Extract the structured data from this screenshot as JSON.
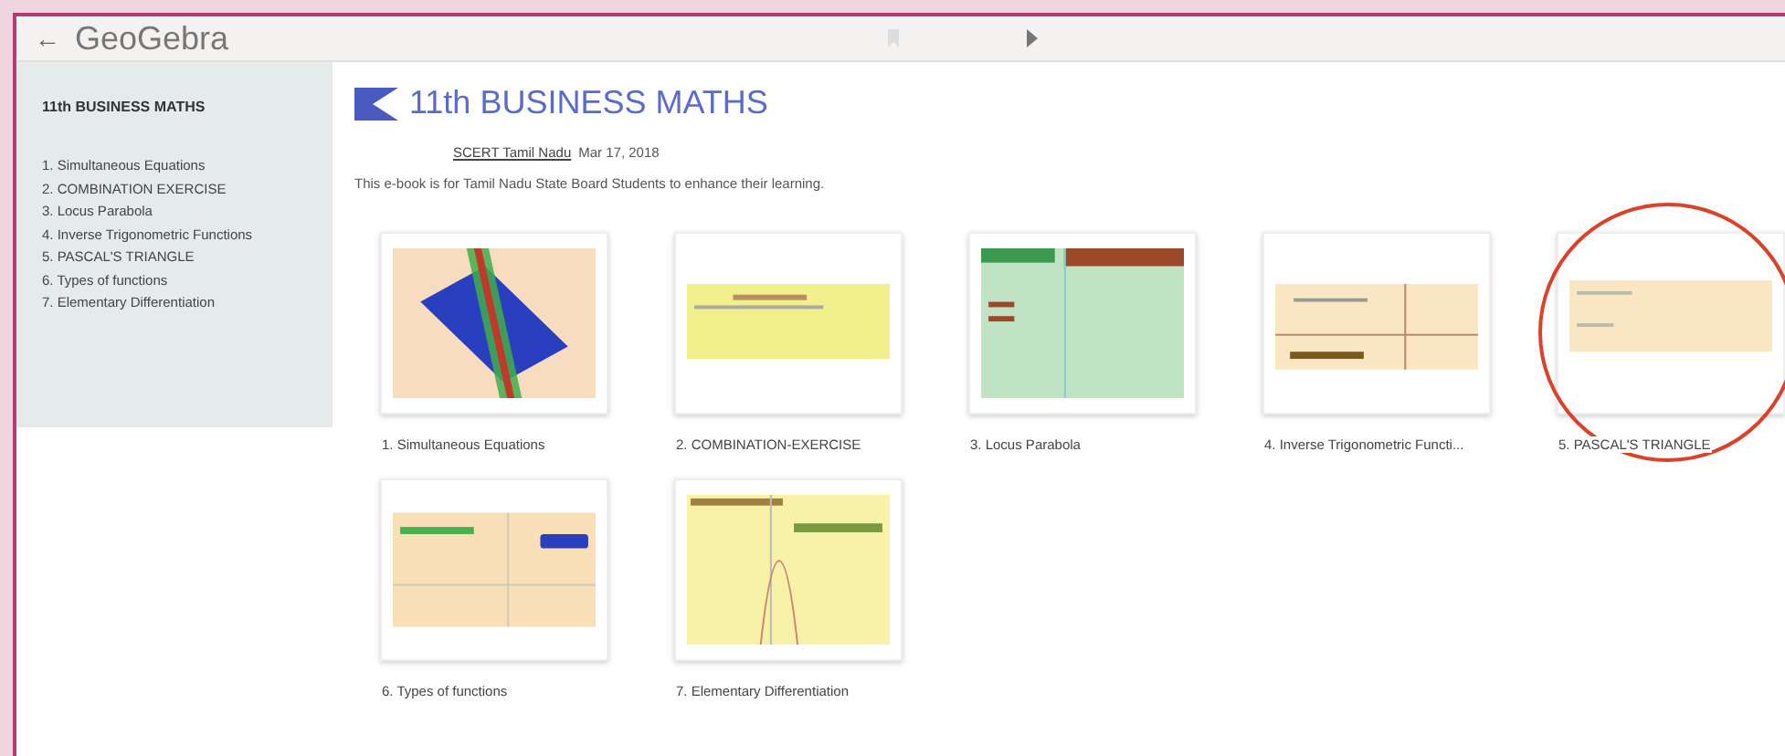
{
  "top_bar": {
    "back": "←",
    "title": "GeoGebra"
  },
  "sidebar": {
    "heading": "11th BUSINESS MATHS",
    "items": [
      {
        "label": "1. Simultaneous Equations"
      },
      {
        "label": "2. COMBINATION EXERCISE"
      },
      {
        "label": "3. Locus Parabola"
      },
      {
        "label": "4. Inverse Trigonometric Functions"
      },
      {
        "label": "5. PASCAL'S TRIANGLE"
      },
      {
        "label": "6. Types of functions"
      },
      {
        "label": "7. Elementary Differentiation"
      }
    ]
  },
  "book": {
    "title": "11th BUSINESS MATHS",
    "author": "SCERT Tamil Nadu",
    "date": "Mar 17, 2018",
    "description": "This e-book is for Tamil Nadu State Board Students to enhance their learning."
  },
  "cards": [
    {
      "kind": "planes",
      "label": "1. Simultaneous Equations",
      "highlighted": false
    },
    {
      "kind": "yellow",
      "label": "2. COMBINATION-EXERCISE",
      "highlighted": false
    },
    {
      "kind": "green",
      "label": "3. Locus Parabola",
      "highlighted": false
    },
    {
      "kind": "graph",
      "label": "4. Inverse Trigonometric Functi...",
      "highlighted": false
    },
    {
      "kind": "plain",
      "label": "5. PASCAL'S TRIANGLE",
      "highlighted": true
    },
    {
      "kind": "functions",
      "label": "6. Types of functions",
      "highlighted": false
    },
    {
      "kind": "curve",
      "label": "7. Elementary Differentiation",
      "highlighted": false
    }
  ]
}
